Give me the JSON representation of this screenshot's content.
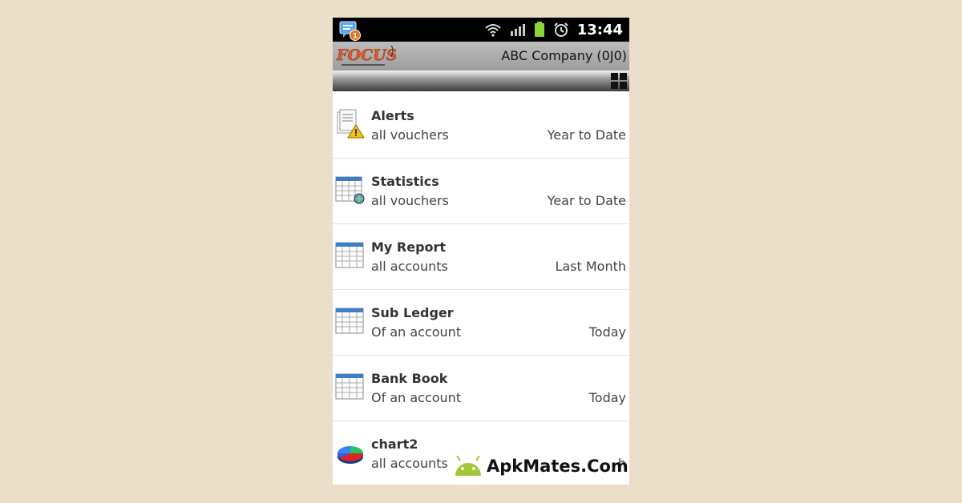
{
  "status_bar": {
    "notification_count": "1",
    "time": "13:44"
  },
  "app_bar": {
    "logo_text": "FOCUS",
    "company": "ABC Company (0J0)"
  },
  "reports": [
    {
      "icon": "alerts-icon",
      "title": "Alerts",
      "subtitle": "all vouchers",
      "period": "Year to Date"
    },
    {
      "icon": "statistics-icon",
      "title": "Statistics",
      "subtitle": "all vouchers",
      "period": "Year to Date"
    },
    {
      "icon": "table-icon",
      "title": "My Report",
      "subtitle": "all accounts",
      "period": "Last Month"
    },
    {
      "icon": "table-icon",
      "title": "Sub Ledger",
      "subtitle": "Of an account",
      "period": "Today"
    },
    {
      "icon": "table-icon",
      "title": "Bank Book",
      "subtitle": "Of an account",
      "period": "Today"
    },
    {
      "icon": "pie-chart-icon",
      "title": "chart2",
      "subtitle": "all accounts",
      "period": "h"
    }
  ],
  "watermark": {
    "text": "ApkMates.Com",
    "icon": "android-icon",
    "color": "#a4c639"
  },
  "colors": {
    "background": "#ecdfca",
    "logo_orange": "#e0592a"
  }
}
